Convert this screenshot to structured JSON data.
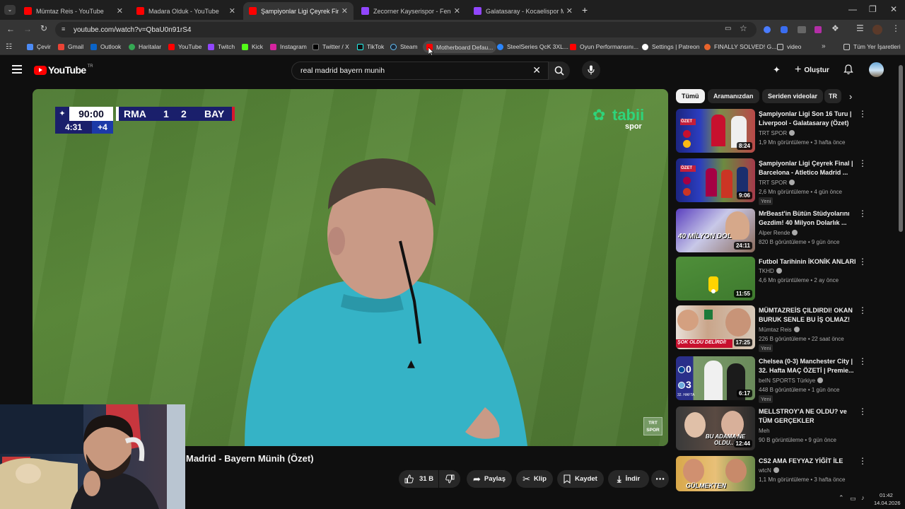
{
  "tabs": [
    {
      "title": "Mümtaz Reis - YouTube"
    },
    {
      "title": "Madara Olduk - YouTube"
    },
    {
      "title": "Şampiyonlar Ligi Çeyrek Final |"
    },
    {
      "title": "Zecorner Kayserispor - Fenerba"
    },
    {
      "title": "Galatasaray - Kocaelispor Maç"
    }
  ],
  "omnibox": {
    "url": "youtube.com/watch?v=QbaU0n91rS4"
  },
  "bookmarks": [
    {
      "label": "Çevir"
    },
    {
      "label": "Gmail"
    },
    {
      "label": "Outlook"
    },
    {
      "label": "Haritalar"
    },
    {
      "label": "YouTube"
    },
    {
      "label": "Twitch"
    },
    {
      "label": "Kick"
    },
    {
      "label": "Instagram"
    },
    {
      "label": "Twitter / X"
    },
    {
      "label": "TikTok"
    },
    {
      "label": "Steam"
    },
    {
      "label": "Motherboard Defau..."
    },
    {
      "label": "SteelSeries QcK 3XL..."
    },
    {
      "label": "Oyun Performansını..."
    },
    {
      "label": "Settings | Patreon"
    },
    {
      "label": "FINALLY SOLVED! G..."
    },
    {
      "label": "video"
    },
    {
      "label": "Tüm Yer İşaretleri"
    }
  ],
  "youtube": {
    "logo_text": "YouTube",
    "region": "TR",
    "search_value": "real madrid bayern munih",
    "create_label": "Oluştur"
  },
  "scoreboard": {
    "time": "90:00",
    "home": "RMA",
    "home_score": "1",
    "away_score": "2",
    "away": "BAY",
    "stoppage_clock": "4:31",
    "added_time": "+4",
    "broadcaster": "tabii",
    "broadcaster_sub": "spor",
    "watermark": "TRT SPOR"
  },
  "video": {
    "title": "Madrid - Bayern Münih (Özet)",
    "likes": "31 B",
    "share": "Paylaş",
    "clip": "Klip",
    "save": "Kaydet",
    "download": "İndir"
  },
  "chips": [
    "Tümü",
    "Aramanızdan",
    "Seriden videolar",
    "TR"
  ],
  "recommendations": [
    {
      "title": "Şampiyonlar Ligi Son 16 Turu | Liverpool - Galatasaray (Özet)",
      "channel": "TRT SPOR",
      "meta": "1,9 Mn görüntüleme • 3 hafta önce",
      "badge": "",
      "duration": "8:24",
      "verified": true
    },
    {
      "title": "Şampiyonlar Ligi Çeyrek Final | Barcelona - Atletico Madrid ...",
      "channel": "TRT SPOR",
      "meta": "2,6 Mn görüntüleme • 4 gün önce",
      "badge": "Yeni",
      "duration": "9:06",
      "verified": true
    },
    {
      "title": "MrBeast'in Bütün Stüdyolarını Gezdim! 40 Milyon Dolarlık ...",
      "channel": "Alper Rende",
      "meta": "820 B görüntüleme • 9 gün önce",
      "badge": "",
      "duration": "24:11",
      "verified": true
    },
    {
      "title": "Futbol Tarihinin İKONİK ANLARI",
      "channel": "TKHD",
      "meta": "4,6 Mn görüntüleme • 2 ay önce",
      "badge": "",
      "duration": "11:55",
      "verified": true
    },
    {
      "title": "MÜMTAZREİS ÇILDIRDI! OKAN BURUK SENLE BU İŞ OLMAZ! ...",
      "channel": "Mümtaz Reis",
      "meta": "226 B görüntüleme • 22 saat önce",
      "badge": "Yeni",
      "duration": "17:25",
      "verified": true
    },
    {
      "title": "Chelsea (0-3) Manchester City | 32. Hafta MAÇ ÖZETİ | Premie...",
      "channel": "beIN SPORTS Türkiye",
      "meta": "448 B görüntüleme • 1 gün önce",
      "badge": "Yeni",
      "duration": "6:17",
      "verified": true
    },
    {
      "title": "MELLSTROY'A NE OLDU? ve TÜM GERÇEKLER",
      "channel": "Meh",
      "meta": "90 B görüntüleme • 9 gün önce",
      "badge": "",
      "duration": "12:44",
      "verified": false
    },
    {
      "title": "CS2 AMA FEYYAZ YİĞİT İLE",
      "channel": "wtcN",
      "meta": "1,1 Mn görüntüleme • 3 hafta önce",
      "badge": "",
      "duration": "",
      "verified": true
    }
  ],
  "thumb_text": {
    "r1": "ÖZET",
    "r2": "ÖZET",
    "r3": "40 MİLYON DOL",
    "r5": "ŞOK OLDU DELİRDİ!",
    "r6": "32. HAFTA",
    "r7": "BU ADAMA NE OLDU..?",
    "r8": "GÜLMEKTEN"
  },
  "taskbar": {
    "time": "01:42",
    "date": "14.04.2026"
  },
  "colors": {
    "yt_red": "#ff0000",
    "bg": "#0f0f0f",
    "chip": "#272727",
    "pitch": "#5c8a3b",
    "referee_shirt": "#37b6c8",
    "scoreboard_navy": "#1a1f6b"
  }
}
